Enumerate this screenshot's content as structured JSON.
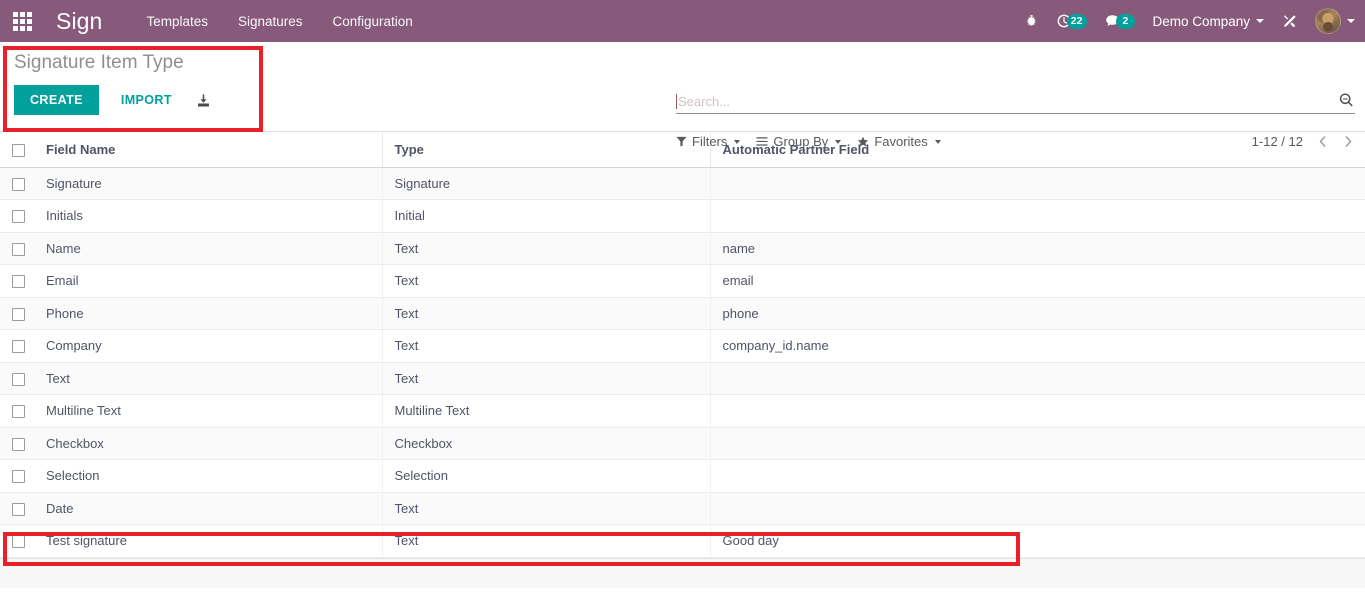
{
  "navbar": {
    "apps_icon": "apps-grid-icon",
    "brand": "Sign",
    "menu": [
      {
        "label": "Templates"
      },
      {
        "label": "Signatures"
      },
      {
        "label": "Configuration"
      }
    ],
    "debug_icon": "bug-icon",
    "activity_icon": "clock-activity-icon",
    "activity_count": "22",
    "messages_icon": "chat-bubble-icon",
    "messages_count": "2",
    "company": "Demo Company",
    "tools_icon": "crossed-tools-icon",
    "avatar_icon": "user-avatar",
    "accent_color": "#875A7B",
    "badge_color": "#00A09D"
  },
  "control_panel": {
    "title": "Signature Item Type",
    "create_label": "CREATE",
    "import_label": "IMPORT",
    "download_icon": "download-import-icon",
    "button_color": "#00A09D"
  },
  "search": {
    "placeholder": "Search...",
    "value": "",
    "search_icon": "magnifier-icon"
  },
  "filters": {
    "filters_label": "Filters",
    "filters_icon": "funnel-icon",
    "group_by_label": "Group By",
    "group_by_icon": "hamburger-lines-icon",
    "favorites_label": "Favorites",
    "favorites_icon": "star-icon",
    "pager_count": "1-12 / 12",
    "prev_icon": "chevron-left-icon",
    "next_icon": "chevron-right-icon"
  },
  "table": {
    "columns": [
      "Field Name",
      "Type",
      "Automatic Partner Field"
    ],
    "rows": [
      {
        "field_name": "Signature",
        "type": "Signature",
        "auto_field": ""
      },
      {
        "field_name": "Initials",
        "type": "Initial",
        "auto_field": ""
      },
      {
        "field_name": "Name",
        "type": "Text",
        "auto_field": "name"
      },
      {
        "field_name": "Email",
        "type": "Text",
        "auto_field": "email"
      },
      {
        "field_name": "Phone",
        "type": "Text",
        "auto_field": "phone"
      },
      {
        "field_name": "Company",
        "type": "Text",
        "auto_field": "company_id.name"
      },
      {
        "field_name": "Text",
        "type": "Text",
        "auto_field": ""
      },
      {
        "field_name": "Multiline Text",
        "type": "Multiline Text",
        "auto_field": ""
      },
      {
        "field_name": "Checkbox",
        "type": "Checkbox",
        "auto_field": ""
      },
      {
        "field_name": "Selection",
        "type": "Selection",
        "auto_field": ""
      },
      {
        "field_name": "Date",
        "type": "Text",
        "auto_field": ""
      },
      {
        "field_name": "Test signature",
        "type": "Text",
        "auto_field": "Good day"
      }
    ]
  },
  "annotations": {
    "highlight_color": "#E8202A",
    "boxes": [
      "header-create-area",
      "test-signature-row"
    ]
  }
}
